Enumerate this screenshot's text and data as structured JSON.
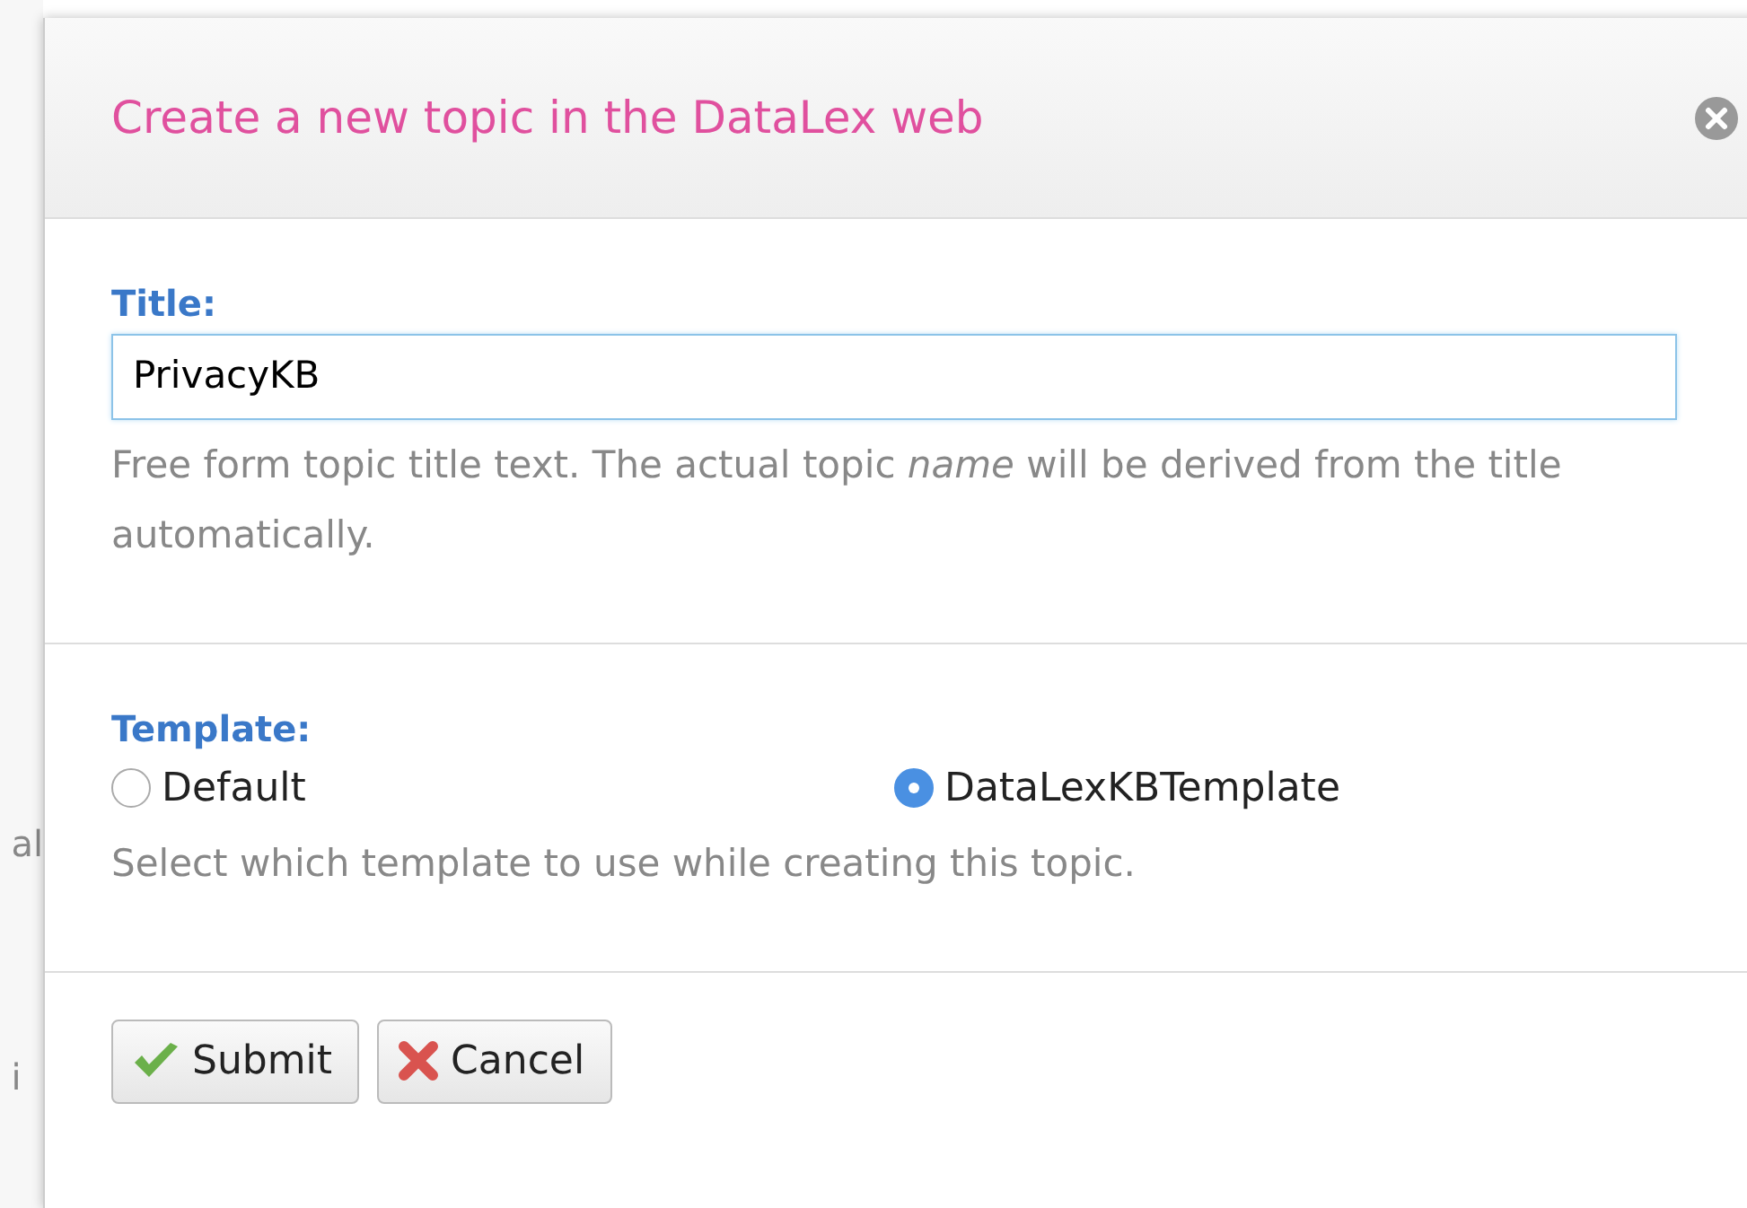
{
  "background": {
    "fragments": [
      "al",
      "i"
    ]
  },
  "dialog": {
    "title": "Create a new topic in the DataLex web"
  },
  "fields": [
    {
      "kind": "text",
      "label": "Title:",
      "value": "PrivacyKB",
      "help": "Free form topic title text. The actual topic *name* will be derived from the title automatically."
    },
    {
      "kind": "radio",
      "label": "Template:",
      "options": [
        {
          "label": "Default",
          "selected": false
        },
        {
          "label": "DataLexKBTemplate",
          "selected": true
        }
      ],
      "help": "Select which template to use while creating this topic."
    }
  ],
  "buttons": [
    {
      "kind": "submit",
      "label": "Submit"
    },
    {
      "kind": "cancel",
      "label": "Cancel"
    }
  ]
}
